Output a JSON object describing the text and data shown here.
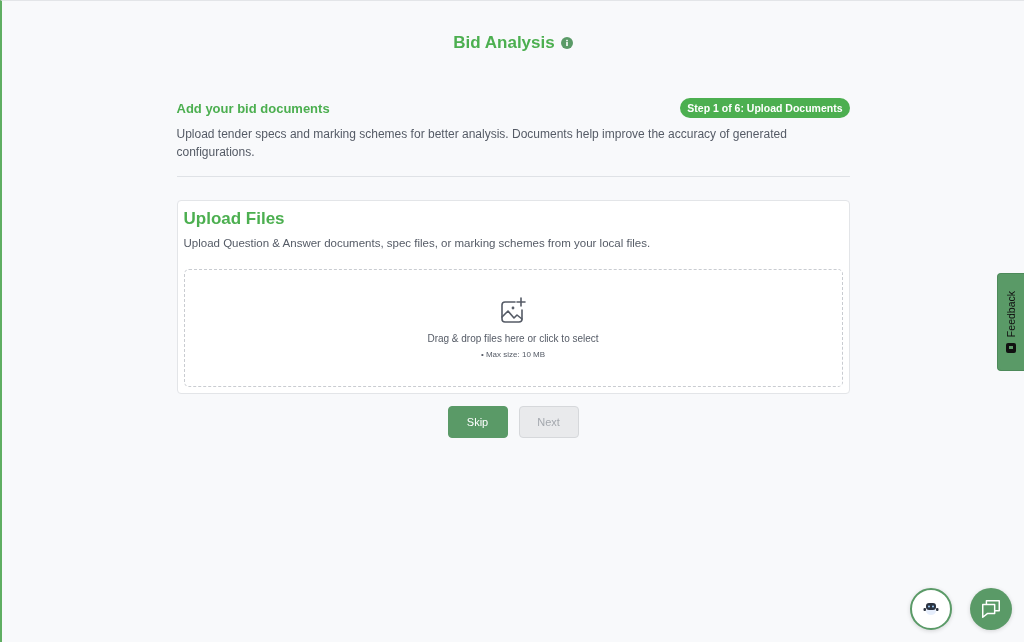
{
  "header": {
    "title": "Bid Analysis"
  },
  "intro": {
    "heading": "Add your bid documents",
    "step_badge": "Step 1 of 6: Upload Documents",
    "description": "Upload tender specs and marking schemes for better analysis. Documents help improve the accuracy of generated configurations."
  },
  "upload_card": {
    "title": "Upload Files",
    "description": "Upload Question & Answer documents, spec files, or marking schemes from your local files.",
    "dropzone": {
      "prompt": "Drag & drop files here or click to select",
      "hint": "• Max size: 10 MB"
    }
  },
  "buttons": [
    {
      "label": "Skip",
      "disabled": false
    },
    {
      "label": "Next",
      "disabled": true
    }
  ],
  "feedback_tab": {
    "label": "Feedback"
  }
}
